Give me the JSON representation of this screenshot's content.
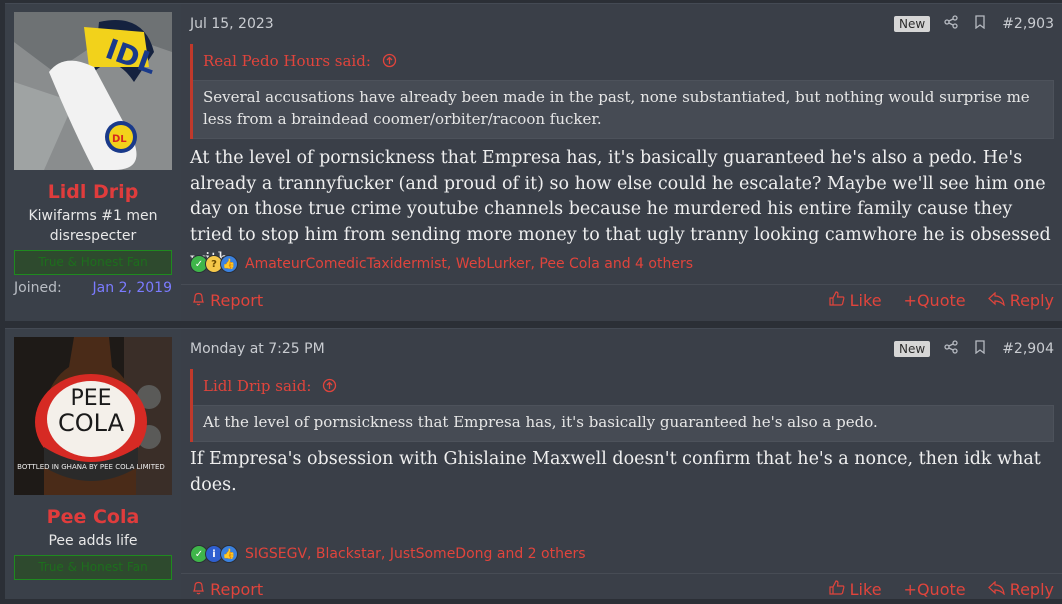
{
  "posts": [
    {
      "user": {
        "name": "Lidl Drip",
        "title_lines": [
          "Kiwifarms #1 men",
          "disrespecter"
        ],
        "banner": "True & Honest Fan",
        "joined_label": "Joined:",
        "joined_date": "Jan 2, 2019"
      },
      "date": "Jul 15, 2023",
      "badge": "New",
      "post_number": "#2,903",
      "quote": {
        "author": "Real Pedo Hours said:",
        "text": "Several accusations have already been made in the past, none substantiated, but nothing would surprise me less from a braindead coomer/orbiter/racoon fucker."
      },
      "body": "At the level of pornsickness that Empresa has, it's basically guaranteed he's also a pedo. He's already a trannyfucker (and proud of it) so how else could he escalate? Maybe we'll see him one day on those true crime youtube channels because he murdered his entire family cause they tried to stop him from sending more money to that ugly tranny looking camwhore he is obsessed with.",
      "reactions": "AmateurComedicTaxidermist, WebLurker, Pee Cola and 4 others",
      "actions": {
        "report": "Report",
        "like": "Like",
        "quote": "Quote",
        "reply": "Reply"
      }
    },
    {
      "user": {
        "name": "Pee Cola",
        "title_lines": [
          "Pee adds life"
        ],
        "banner": "True & Honest Fan"
      },
      "date": "Monday at 7:25 PM",
      "badge": "New",
      "post_number": "#2,904",
      "quote": {
        "author": "Lidl Drip said:",
        "text": "At the level of pornsickness that Empresa has, it's basically guaranteed he's also a pedo."
      },
      "body": "If Empresa's obsession with Ghislaine Maxwell doesn't confirm that he's a nonce, then idk what does.",
      "reactions": "SIGSEGV, Blackstar, JustSomeDong and 2 others",
      "actions": {
        "report": "Report",
        "like": "Like",
        "quote": "Quote",
        "reply": "Reply"
      }
    }
  ],
  "avatar_texts": {
    "pee_cola_label_top": "PEE",
    "pee_cola_label_bottom": "COLA",
    "pee_cola_small": "BOTTLED IN GHANA BY PEE COLA LIMITED"
  },
  "icons": [
    "share-icon",
    "bookmark-icon",
    "arrow-up-circle-icon",
    "bell-icon",
    "thumbs-up-icon",
    "plus-icon",
    "reply-arrow-icon"
  ],
  "colors": {
    "accent": "#e03c3c",
    "background": "#2b2f36",
    "post_bg": "#3a3f48",
    "joined_date": "#7b7bff"
  }
}
